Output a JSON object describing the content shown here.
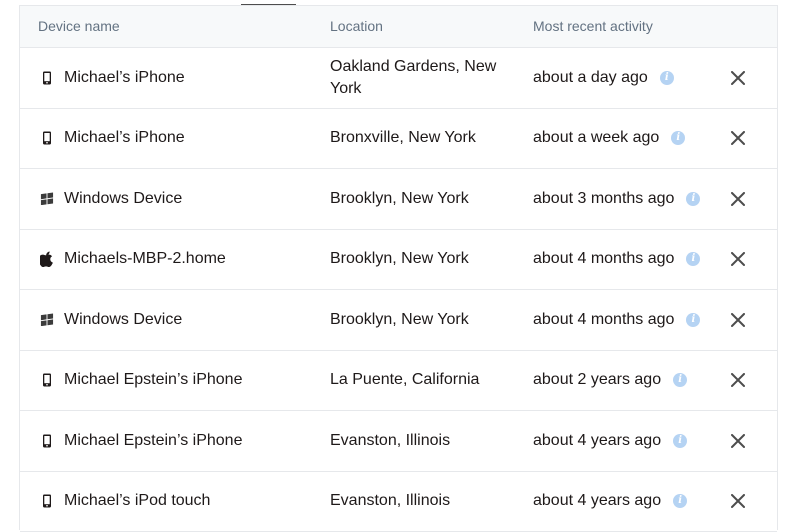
{
  "header": {
    "device_name": "Device name",
    "location": "Location",
    "activity": "Most recent activity"
  },
  "devices": [
    {
      "icon": "mobile-phone-icon",
      "name": "Michael’s iPhone",
      "location": "Oakland Gardens, New York",
      "activity": "about a day ago"
    },
    {
      "icon": "mobile-phone-icon",
      "name": "Michael’s iPhone",
      "location": "Bronxville, New York",
      "activity": "about a week ago"
    },
    {
      "icon": "windows-logo-icon",
      "name": "Windows Device",
      "location": "Brooklyn, New York",
      "activity": "about 3 months ago"
    },
    {
      "icon": "apple-logo-icon",
      "name": "Michaels-MBP-2.home",
      "location": "Brooklyn, New York",
      "activity": "about 4 months ago"
    },
    {
      "icon": "windows-logo-icon",
      "name": "Windows Device",
      "location": "Brooklyn, New York",
      "activity": "about 4 months ago"
    },
    {
      "icon": "mobile-phone-icon",
      "name": "Michael Epstein’s iPhone",
      "location": "La Puente, California",
      "activity": "about 2 years ago"
    },
    {
      "icon": "mobile-phone-icon",
      "name": "Michael Epstein’s iPhone",
      "location": "Evanston, Illinois",
      "activity": "about 4 years ago"
    },
    {
      "icon": "mobile-phone-icon",
      "name": "Michael’s iPod touch",
      "location": "Evanston, Illinois",
      "activity": "about 4 years ago"
    }
  ],
  "colors": {
    "info_icon": "#b5d3f3",
    "header_bg": "#f7f9fa",
    "border": "#e6e8eb",
    "header_text": "#637282",
    "text": "#1e1919"
  }
}
